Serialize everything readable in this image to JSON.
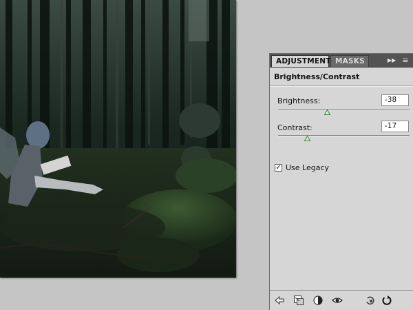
{
  "panel": {
    "tabs": [
      {
        "label": "ADJUSTMENTS",
        "active": true
      },
      {
        "label": "MASKS",
        "active": false
      }
    ],
    "title": "Brightness/Contrast",
    "brightness": {
      "label": "Brightness:",
      "value": "-38",
      "min": -150,
      "max": 150
    },
    "contrast": {
      "label": "Contrast:",
      "value": "-17",
      "min": -50,
      "max": 100
    },
    "use_legacy": {
      "label": "Use Legacy",
      "checked": true
    }
  },
  "icons": {
    "panel_menu": "expand-collapse-icon",
    "panel_options": "panel-menu-icon",
    "bottom": [
      "return-to-list-icon",
      "clip-to-layer-icon",
      "layer-visibility-icon",
      "view-previous-state-icon",
      "reset-icon",
      "reset-default-icon"
    ]
  },
  "colors": {
    "panel_bg": "#d6d6d6",
    "tabbar_bg": "#535353",
    "thumb": "#2f8a2f"
  }
}
